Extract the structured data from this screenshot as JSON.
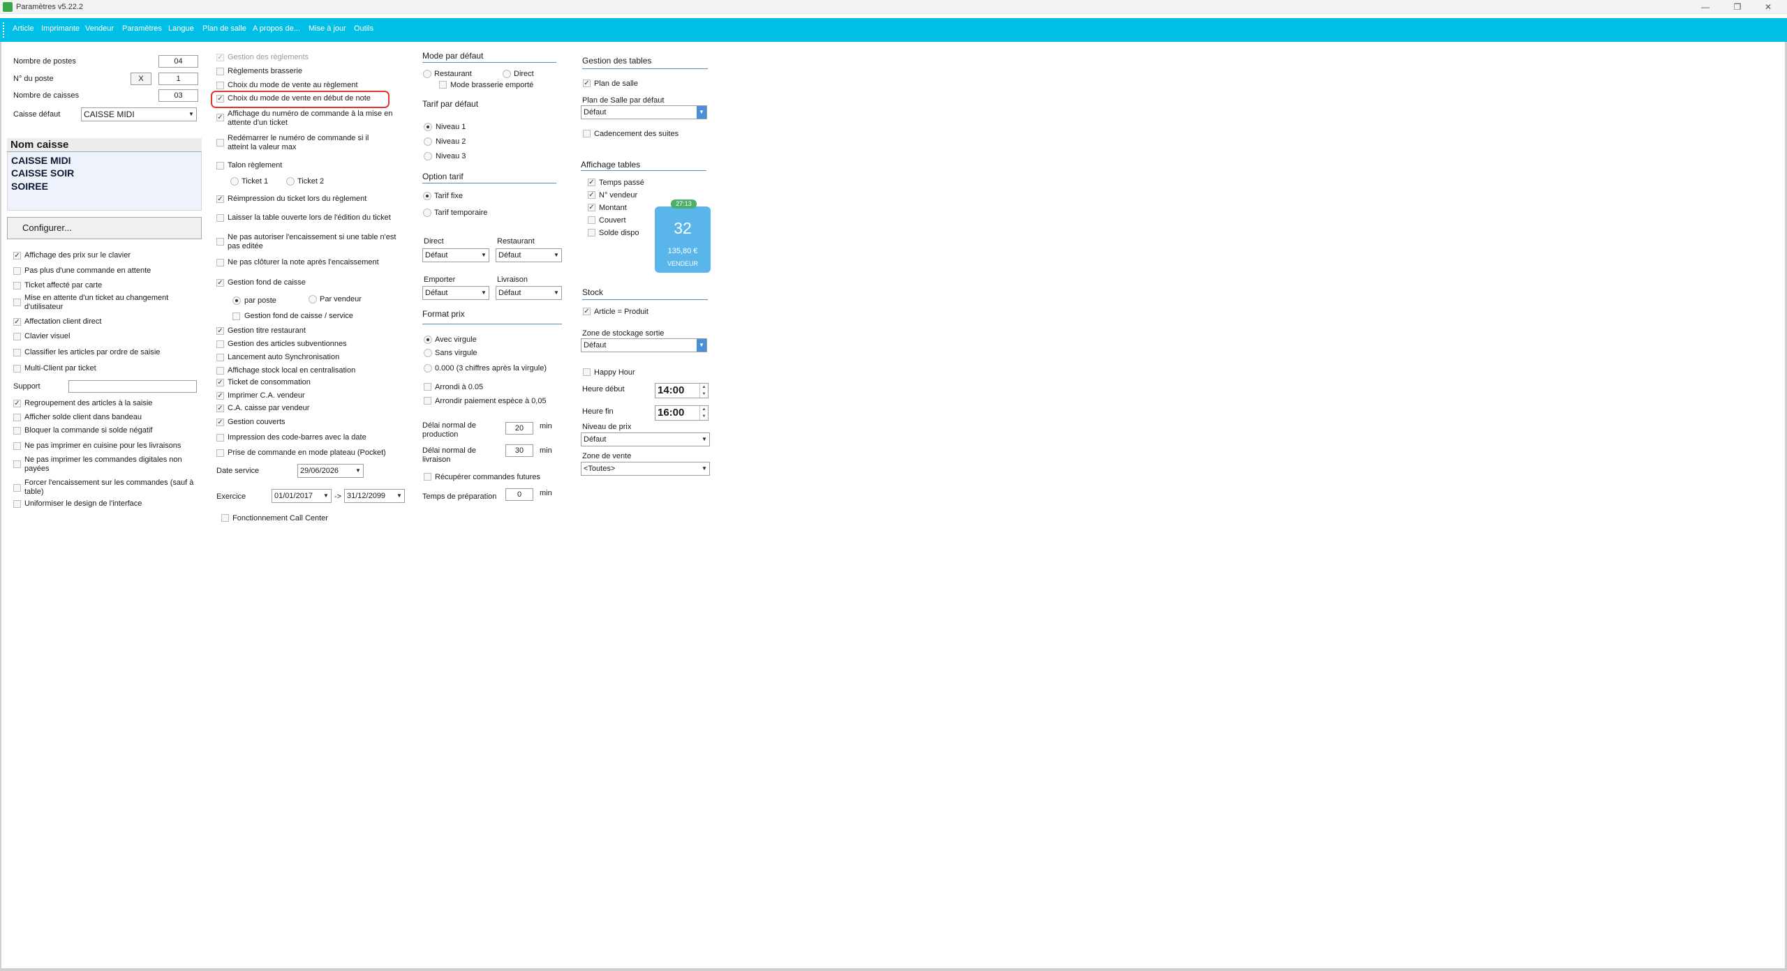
{
  "window": {
    "title": "Paramètres v5.22.2"
  },
  "menu": [
    "Article",
    "Imprimante",
    "Vendeur",
    "Paramètres",
    "Langue",
    "Plan de salle",
    "A propos de...",
    "Mise à jour",
    "Outils"
  ],
  "col1": {
    "nb_postes_label": "Nombre de postes",
    "nb_postes": "04",
    "num_poste_label": "N° du poste",
    "x_label": "X",
    "num_poste": "1",
    "nb_caisses_label": "Nombre de caisses",
    "nb_caisses": "03",
    "caisse_defaut_label": "Caisse défaut",
    "caisse_defaut": "CAISSE MIDI",
    "list_header": "Nom caisse",
    "caisses": [
      "CAISSE MIDI",
      "CAISSE SOIR",
      "SOIREE"
    ],
    "configure": "Configurer...",
    "options": [
      {
        "label": "Affichage des prix sur le clavier",
        "checked": true
      },
      {
        "label": "Pas plus d'une commande en attente",
        "checked": false
      },
      {
        "label": "Ticket affecté par carte",
        "checked": false
      },
      {
        "label": "Mise en attente d'un ticket au changement d'utilisateur",
        "checked": false
      },
      {
        "label": "Affectation client direct",
        "checked": true
      },
      {
        "label": "Clavier visuel",
        "checked": false
      },
      {
        "label": "Classifier les articles par ordre de saisie",
        "checked": false
      },
      {
        "label": "Multi-Client par ticket",
        "checked": false
      }
    ],
    "support_label": "Support",
    "options2": [
      {
        "label": "Regroupement des articles à la saisie",
        "checked": true
      },
      {
        "label": "Afficher solde client dans bandeau",
        "checked": false
      },
      {
        "label": "Bloquer la commande si solde négatif",
        "checked": false
      },
      {
        "label": "Ne pas imprimer en cuisine pour les livraisons",
        "checked": false
      },
      {
        "label": "Ne pas imprimer les commandes digitales non payées",
        "checked": false
      },
      {
        "label": "Forcer l'encaissement sur les commandes (sauf à table)",
        "checked": false
      },
      {
        "label": "Uniformiser le design de l'interface",
        "checked": false
      }
    ]
  },
  "col2": {
    "gestion_reglements": "Gestion des règlements",
    "reglements_brasserie": "Règlements brasserie",
    "choix_mode_reglement": "Choix du mode de vente au règlement",
    "choix_mode_debut": "Choix du mode de vente en début de note",
    "affichage_numero": "Affichage du numéro de commande à la mise en attente d'un ticket",
    "redemarrer": "Redémarrer le numéro de commande si il atteint la valeur max",
    "talon": "Talon règlement",
    "ticket1": "Ticket 1",
    "ticket2": "Ticket 2",
    "reimpression": "Réimpression du ticket lors du règlement",
    "laisser_table": "Laisser la table ouverte lors de l'édition du ticket",
    "ne_pas_autoriser": "Ne pas autoriser l'encaissement si une table n'est pas editée",
    "ne_pas_cloturer": "Ne pas clôturer la note après l'encaissement",
    "fond_caisse": "Gestion fond de caisse",
    "par_poste": "par poste",
    "par_vendeur": "Par vendeur",
    "fond_service": "Gestion fond de caisse / service",
    "options": [
      {
        "label": "Gestion titre restaurant",
        "checked": true
      },
      {
        "label": "Gestion des articles subventionnes",
        "checked": false
      },
      {
        "label": "Lancement auto Synchronisation",
        "checked": false
      },
      {
        "label": "Affichage stock local en centralisation",
        "checked": false
      },
      {
        "label": "Ticket de consommation",
        "checked": true
      },
      {
        "label": "Imprimer C.A. vendeur",
        "checked": true
      },
      {
        "label": "C.A. caisse par vendeur",
        "checked": true
      },
      {
        "label": "Gestion couverts",
        "checked": true
      },
      {
        "label": "Impression des code-barres avec la date",
        "checked": false
      },
      {
        "label": "Prise de commande en mode plateau (Pocket)",
        "checked": false
      }
    ],
    "date_service_label": "Date service",
    "date_service": "29/06/2026",
    "exercice_label": "Exercice",
    "exercice_from": "01/01/2017",
    "arrow": "->",
    "exercice_to": "31/12/2099",
    "call_center": "Fonctionnement Call Center"
  },
  "col3": {
    "mode_defaut": "Mode par défaut",
    "restaurant": "Restaurant",
    "direct": "Direct",
    "mode_brasserie": "Mode brasserie emporté",
    "tarif_defaut": "Tarif par défaut",
    "niveau1": "Niveau 1",
    "niveau2": "Niveau 2",
    "niveau3": "Niveau 3",
    "option_tarif": "Option tarif",
    "tarif_fixe": "Tarif fixe",
    "tarif_temporaire": "Tarif temporaire",
    "direct_label": "Direct",
    "restaurant_label": "Restaurant",
    "emporter_label": "Emporter",
    "livraison_label": "Livraison",
    "defaut": "Défaut",
    "format_prix": "Format prix",
    "avec_virgule": "Avec virgule",
    "sans_virgule": "Sans virgule",
    "trois_chiffres": "0.000 (3 chiffres après la virgule)",
    "arrondi": "Arrondi à 0.05",
    "arrondir_paiement": "Arrondir paiement espèce à 0,05",
    "delai_production": "Délai normal de production",
    "delai_production_val": "20",
    "delai_livraison": "Délai normal de livraison",
    "delai_livraison_val": "30",
    "min": "min",
    "recuperer": "Récupérer commandes futures",
    "temps_preparation": "Temps de préparation",
    "temps_preparation_val": "0"
  },
  "col4": {
    "gestion_tables": "Gestion des tables",
    "plan_salle": "Plan de salle",
    "plan_salle_defaut_label": "Plan de Salle par défaut",
    "plan_salle_defaut": "Défaut",
    "cadencement": "Cadencement des suites",
    "affichage_tables": "Affichage tables",
    "aff_opts": [
      {
        "label": "Temps passé",
        "checked": true
      },
      {
        "label": "N° vendeur",
        "checked": true
      },
      {
        "label": "Montant",
        "checked": true
      },
      {
        "label": "Couvert",
        "checked": false
      },
      {
        "label": "Solde dispo",
        "checked": false
      }
    ],
    "card": {
      "time": "27:13",
      "number": "32",
      "amount": "135,80 €",
      "vendor": "VENDEUR",
      "color": "#5ab6ea"
    },
    "stock": "Stock",
    "article_produit": "Article = Produit",
    "zone_stockage_label": "Zone de stockage sortie",
    "zone_stockage": "Défaut",
    "happy_hour": "Happy Hour",
    "heure_debut_label": "Heure début",
    "heure_debut": "14:00",
    "heure_fin_label": "Heure fin",
    "heure_fin": "16:00",
    "niveau_prix_label": "Niveau de prix",
    "niveau_prix": "Défaut",
    "zone_vente_label": "Zone de vente",
    "zone_vente": "<Toutes>"
  },
  "colors": {
    "menubar": "#00bfe6",
    "highlight": "#e0352b",
    "accent": "#4a8fd8"
  }
}
